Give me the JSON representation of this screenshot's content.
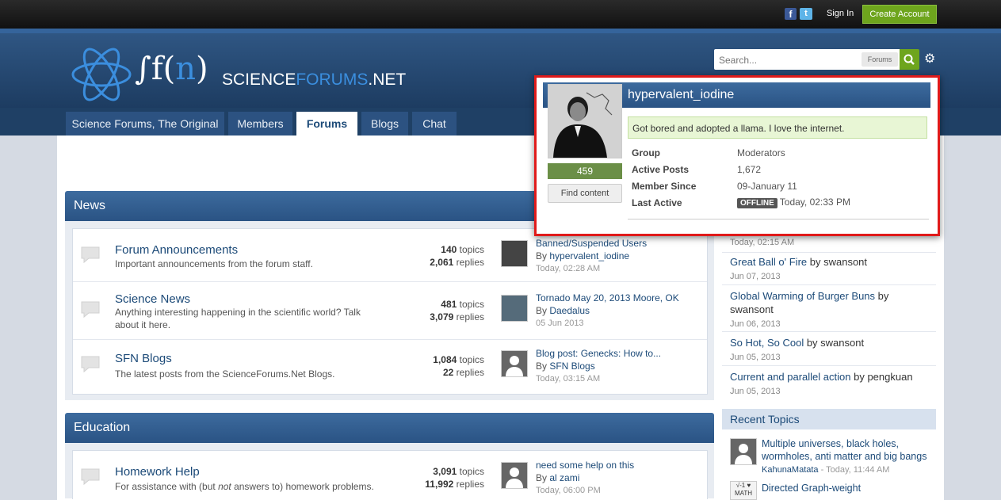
{
  "topbar": {
    "facebook_glyph": "f",
    "twitter_glyph": "t",
    "sign_in": "Sign In",
    "create_account": "Create Account"
  },
  "logo": {
    "mark": "∫f(",
    "mark_n": "n",
    "mark_close": ")",
    "site_a": "SCIENCE",
    "site_b": "FORUMS",
    "site_c": ".NET"
  },
  "search": {
    "placeholder": "Search...",
    "scope": "Forums"
  },
  "nav": {
    "tabs": [
      {
        "label": "Science Forums, The Original"
      },
      {
        "label": "Members"
      },
      {
        "label": "Forums"
      },
      {
        "label": "Blogs"
      },
      {
        "label": "Chat"
      }
    ]
  },
  "categories": [
    {
      "title": "News",
      "forums": [
        {
          "title": "Forum Announcements",
          "desc": "Important announcements from the forum staff.",
          "topics": "140",
          "replies": "2,061",
          "topics_label": " topics",
          "replies_label": " replies",
          "last_title": "Banned/Suspended Users",
          "last_by": "By ",
          "last_user": "hypervalent_iodine",
          "last_date": "Today, 02:28 AM"
        },
        {
          "title": "Science News",
          "desc": "Anything interesting happening in the scientific world? Talk about it here.",
          "topics": "481",
          "replies": "3,079",
          "topics_label": " topics",
          "replies_label": " replies",
          "last_title": "Tornado May 20, 2013 Moore, OK",
          "last_by": "By ",
          "last_user": "Daedalus",
          "last_date": "05 Jun 2013"
        },
        {
          "title": "SFN Blogs",
          "desc": "The latest posts from the ScienceForums.Net Blogs.",
          "topics": "1,084",
          "replies": "22",
          "topics_label": " topics",
          "replies_label": " replies",
          "last_title": "Blog post: Genecks: How to...",
          "last_by": "By ",
          "last_user": "SFN Blogs",
          "last_date": "Today, 03:15 AM"
        }
      ]
    },
    {
      "title": "Education",
      "forums": [
        {
          "title": "Homework Help",
          "desc_a": "For assistance with (but ",
          "desc_em": "not",
          "desc_b": " answers to) homework problems.",
          "topics": "3,091",
          "replies": "11,992",
          "topics_label": " topics",
          "replies_label": " replies",
          "last_title": "need some help on this",
          "last_by": "By ",
          "last_user": "al zami",
          "last_date": "Today, 06:00 PM"
        }
      ]
    }
  ],
  "sidebar": {
    "partial_date": "Today, 02:15 AM",
    "items": [
      {
        "title": "Great Ball o' Fire",
        "by": " by swansont",
        "date": "Jun 07, 2013"
      },
      {
        "title": "Global Warming of Burger Buns",
        "by": " by swansont",
        "date": "Jun 06, 2013"
      },
      {
        "title": "So Hot,  So Cool",
        "by": " by swansont",
        "date": "Jun 05, 2013"
      },
      {
        "title": "Current and parallel action",
        "by": " by pengkuan",
        "date": "Jun 05, 2013"
      }
    ],
    "recent_topics_title": "Recent Topics",
    "recent": [
      {
        "title": "Multiple universes, black holes, wormholes, anti matter and big bangs",
        "user": "KahunaMatata",
        "date": " - Today, 11:44 AM"
      },
      {
        "title": "Directed Graph-weight",
        "thumb_text": "√-1 ♥ MATH"
      }
    ]
  },
  "popup": {
    "username": "hypervalent_iodine",
    "post_count": "459",
    "find_content": "Find content",
    "status": "Got bored and adopted a llama. I love the internet.",
    "fields": [
      {
        "label": "Group",
        "value": "Moderators"
      },
      {
        "label": "Active Posts",
        "value": "1,672"
      },
      {
        "label": "Member Since",
        "value": "09-January 11"
      },
      {
        "label": "Last Active",
        "badge": "OFFLINE",
        "value": "Today, 02:33 PM"
      }
    ]
  },
  "colors": {
    "accent_green": "#6ea51d",
    "header_blue": "#2f5683",
    "link": "#1c4a78",
    "popup_border": "#e01a1a"
  }
}
